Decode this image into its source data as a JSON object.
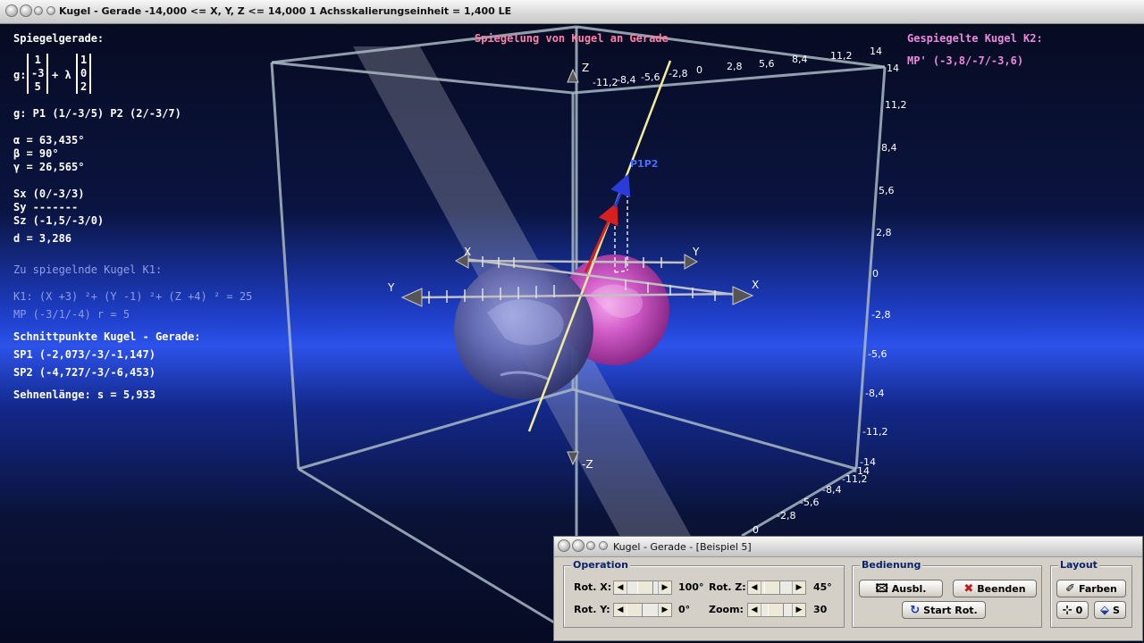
{
  "window": {
    "title": "Kugel - Gerade   -14,000 <= X, Y, Z <= 14,000   1 Achsskalierungseinheit = 1,400 LE"
  },
  "left_info": {
    "heading": "Spiegelgerade:",
    "g_label": "g:",
    "vector_a": [
      "1",
      "-3",
      "5"
    ],
    "plus_lambda": "+ λ",
    "vector_b": [
      "1",
      "0",
      "2"
    ],
    "points": "g: P1 (1/-3/5)   P2 (2/-3/7)",
    "alpha": "α = 63,435°",
    "beta": "β = 90°",
    "gamma": "γ = 26,565°",
    "sx": "Sx (0/-3/3)",
    "sy": "Sy -------",
    "sz": "Sz (-1,5/-3/0)",
    "d": "d = 3,286",
    "k1_heading": "Zu spiegelnde Kugel K1:",
    "k1_eq": "K1: (X +3) ²+ (Y -1) ²+ (Z +4) ² = 25",
    "k1_mp": "MP (-3/1/-4)  r = 5",
    "intersect_heading": "Schnittpunkte Kugel - Gerade:",
    "sp1": "SP1 (-2,073/-3/-1,147)",
    "sp2": "SP2 (-4,727/-3/-6,453)",
    "chord": "Sehnenlänge: s = 5,933"
  },
  "center_title": "Spiegelung von Kugel an Gerade",
  "right_info": {
    "heading": "Gespiegelte Kugel K2:",
    "mp": "MP' (-3,8/-7/-3,6)"
  },
  "scene": {
    "axis_labels": {
      "x": "X",
      "y": "Y",
      "z": "Z",
      "neg_z": "-Z",
      "p1p2": "P1P2"
    },
    "top_ticks": [
      "-11,2",
      "-8,4",
      "-5,6",
      "-2,8",
      "0",
      "2,8",
      "5,6",
      "8,4",
      "11,2",
      "14"
    ],
    "right_ticks": [
      "14",
      "11,2",
      "8,4",
      "5,6",
      "2,8",
      "0",
      "-2,8",
      "-5,6",
      "-8,4",
      "-11,2",
      "-14"
    ],
    "bottom_ticks": [
      "-14",
      "-11,2",
      "-8,4",
      "-5,6",
      "-2,8",
      "0"
    ],
    "colors": {
      "sphere_k1": "#6a6fb0",
      "sphere_k2": "#d05ac8",
      "line": "#f0ec9a",
      "vector_red": "#d62020",
      "vector_blue": "#2a3cd8",
      "frame": "#a8b8c4"
    }
  },
  "panel": {
    "title": "Kugel - Gerade - [Beispiel 5]",
    "operation": {
      "legend": "Operation",
      "rot_x_label": "Rot. X:",
      "rot_x_value": "100°",
      "rot_y_label": "Rot. Y:",
      "rot_y_value": "0°",
      "rot_z_label": "Rot. Z:",
      "rot_z_value": "45°",
      "zoom_label": "Zoom:",
      "zoom_value": "30"
    },
    "bedienung": {
      "legend": "Bedienung",
      "ausbl": "Ausbl.",
      "beenden": "Beenden",
      "start_rot": "Start Rot."
    },
    "layout": {
      "legend": "Layout",
      "farben": "Farben",
      "zero": "0",
      "s": "S"
    }
  }
}
